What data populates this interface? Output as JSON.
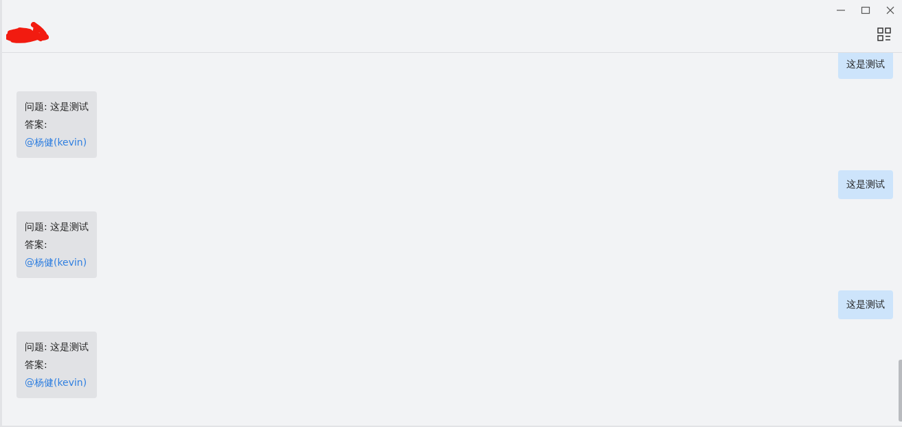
{
  "header": {
    "title_redacted": true
  },
  "messages": [
    {
      "kind": "user",
      "text": "这是测试"
    },
    {
      "kind": "bot",
      "lines": [
        "问题: 这是测试",
        "答案:"
      ],
      "mention": "@杨健(kevin)"
    },
    {
      "kind": "user",
      "text": "这是测试"
    },
    {
      "kind": "bot",
      "lines": [
        "问题: 这是测试",
        "答案:"
      ],
      "mention": "@杨健(kevin)"
    },
    {
      "kind": "user",
      "text": "这是测试"
    },
    {
      "kind": "bot",
      "lines": [
        "问题: 这是测试",
        "答案:"
      ],
      "mention": "@杨健(kevin)"
    }
  ]
}
